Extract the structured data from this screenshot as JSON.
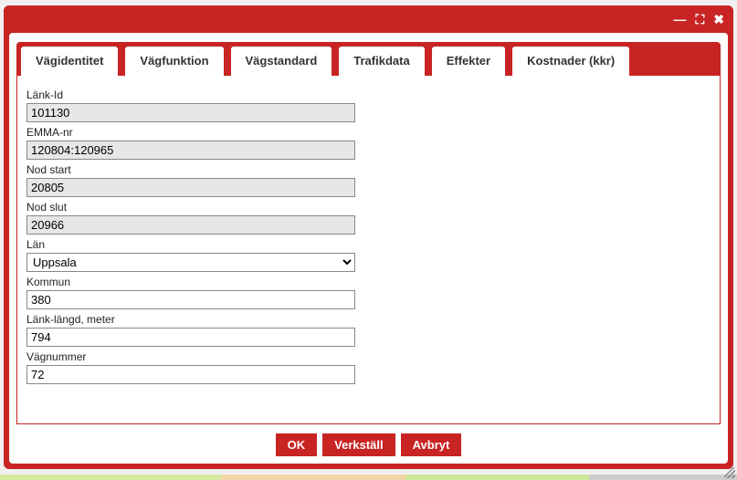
{
  "titlebar": {
    "minimize_glyph": "—",
    "maximize_glyph": "⛶",
    "close_glyph": "✖"
  },
  "tabs": [
    {
      "label": "Vägidentitet",
      "active": true
    },
    {
      "label": "Vägfunktion",
      "active": false
    },
    {
      "label": "Vägstandard",
      "active": false
    },
    {
      "label": "Trafikdata",
      "active": false
    },
    {
      "label": "Effekter",
      "active": false
    },
    {
      "label": "Kostnader (kkr)",
      "active": false
    }
  ],
  "fields": {
    "lank_id": {
      "label": "Länk-Id",
      "value": "101130",
      "readonly": true
    },
    "emma_nr": {
      "label": "EMMA-nr",
      "value": "120804:120965",
      "readonly": true
    },
    "nod_start": {
      "label": "Nod start",
      "value": "20805",
      "readonly": true
    },
    "nod_slut": {
      "label": "Nod slut",
      "value": "20966",
      "readonly": true
    },
    "lan": {
      "label": "Län",
      "value": "Uppsala",
      "type": "select"
    },
    "kommun": {
      "label": "Kommun",
      "value": "380",
      "readonly": false
    },
    "lank_langd": {
      "label": "Länk-längd, meter",
      "value": "794",
      "readonly": false
    },
    "vagnummer": {
      "label": "Vägnummer",
      "value": "72",
      "readonly": false
    }
  },
  "buttons": {
    "ok": "OK",
    "verkstall": "Verkställ",
    "avbryt": "Avbryt"
  }
}
